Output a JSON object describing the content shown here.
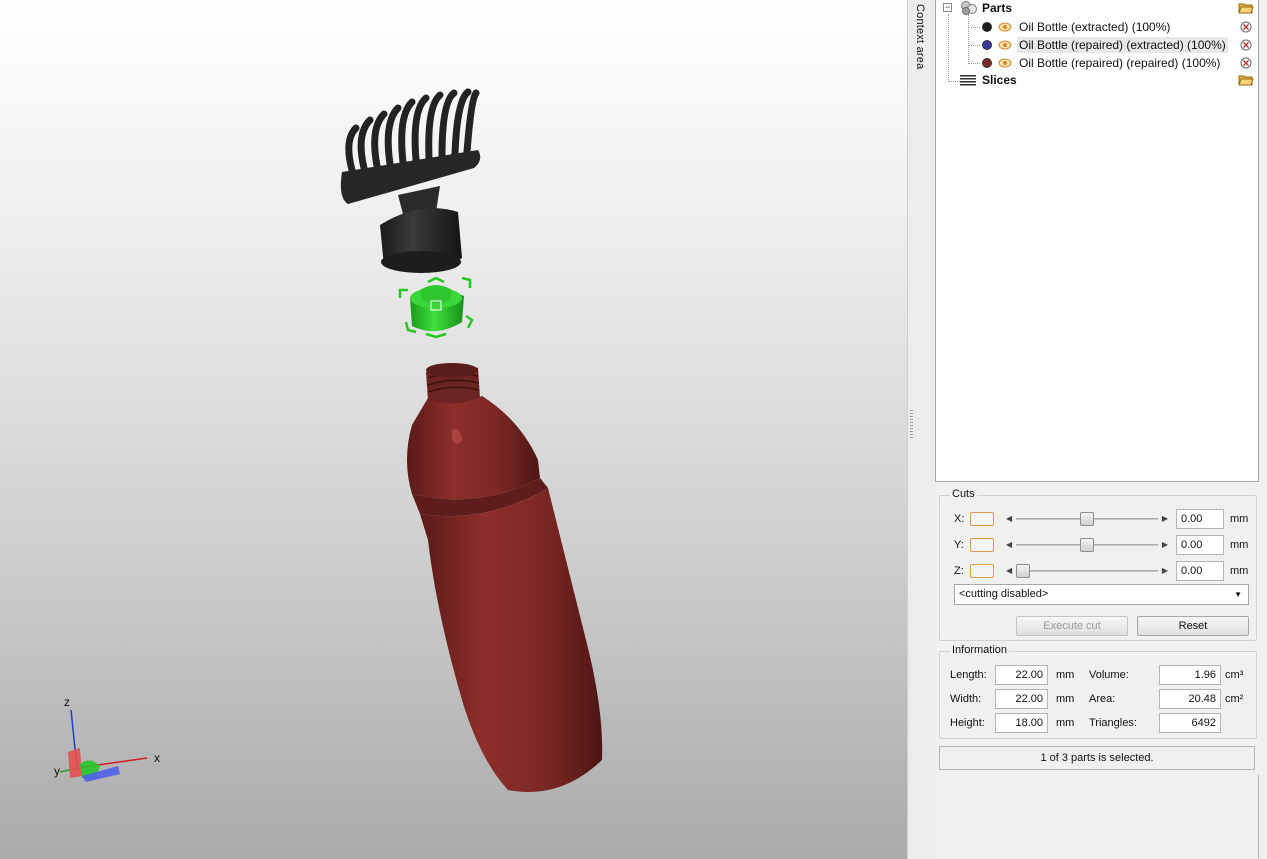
{
  "viewport": {
    "axes": {
      "x_label": "x",
      "y_label": "y",
      "z_label": "z"
    },
    "colors": {
      "comb": "#2b2b2b",
      "selected_part": "#22c922",
      "bottle": "#7b2a27"
    }
  },
  "context_area": {
    "label": "Context area"
  },
  "tree": {
    "parts_label": "Parts",
    "slices_label": "Slices",
    "parts": [
      {
        "name": "Oil Bottle (extracted) (100%)",
        "color": "#1c1c1c"
      },
      {
        "name": "Oil Bottle (repaired) (extracted) (100%)",
        "color": "#3a3896"
      },
      {
        "name": "Oil Bottle (repaired) (repaired) (100%)",
        "color": "#7b2a27"
      }
    ]
  },
  "cuts": {
    "title": "Cuts",
    "axes": [
      {
        "name": "X:",
        "value": "0.00",
        "unit": "mm",
        "slider_fraction": 0.5
      },
      {
        "name": "Y:",
        "value": "0.00",
        "unit": "mm",
        "slider_fraction": 0.5
      },
      {
        "name": "Z:",
        "value": "0.00",
        "unit": "mm",
        "slider_fraction": 0.0
      }
    ],
    "mode_select": "<cutting disabled>",
    "execute_label": "Execute cut",
    "reset_label": "Reset"
  },
  "information": {
    "title": "Information",
    "length_label": "Length:",
    "length": "22.00",
    "length_unit": "mm",
    "width_label": "Width:",
    "width": "22.00",
    "width_unit": "mm",
    "height_label": "Height:",
    "height": "18.00",
    "height_unit": "mm",
    "volume_label": "Volume:",
    "volume": "1.96",
    "volume_unit": "cm³",
    "area_label": "Area:",
    "area": "20.48",
    "area_unit": "cm²",
    "triangles_label": "Triangles:",
    "triangles": "6492"
  },
  "status": "1 of 3 parts is selected."
}
